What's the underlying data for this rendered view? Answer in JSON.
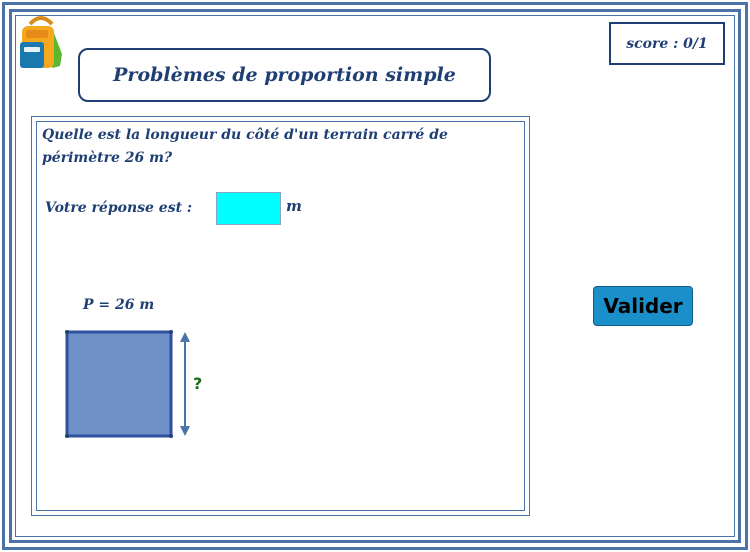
{
  "header": {
    "title": "Problèmes de proportion simple",
    "score": "score : 0/1"
  },
  "icons": {
    "logo": "backpack-icon"
  },
  "question": {
    "text_line1": "Quelle est la longueur du côté d'un terrain carré de",
    "text_line2": "périmètre 26 m?",
    "answer_label": "Votre réponse est :",
    "answer_value": "",
    "unit": "m"
  },
  "figure": {
    "perimeter_label": "P = 26 m",
    "side_label": "?"
  },
  "buttons": {
    "validate": "Valider"
  },
  "colors": {
    "frame": "#4a73a8",
    "title_text": "#1f3f74",
    "input_bg": "#00ffff",
    "square_fill": "#7090c8",
    "button_bg": "#1a8fc9",
    "question_mark": "#1a6b1a"
  }
}
